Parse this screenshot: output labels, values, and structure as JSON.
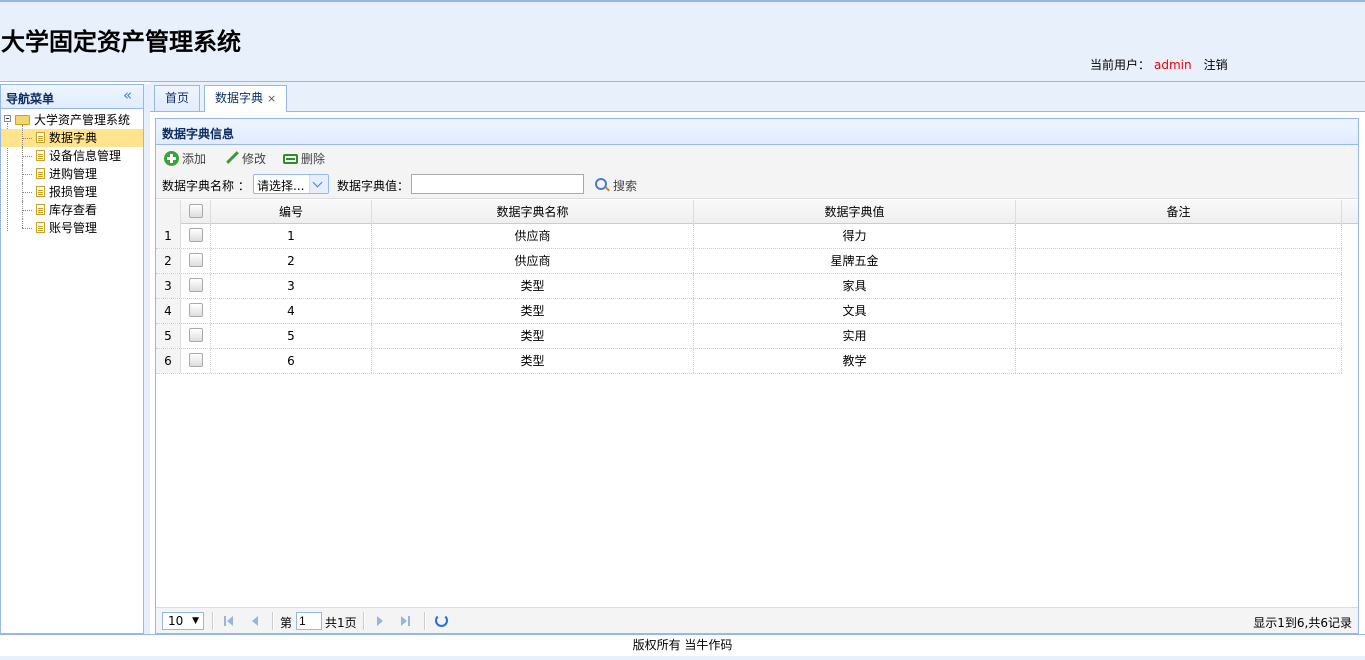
{
  "app": {
    "title": "大学固定资产管理系统",
    "user_label": "当前用户：",
    "username": "admin",
    "logout_label": "注销"
  },
  "nav": {
    "title": "导航菜单",
    "collapse_icon": "double-chevron-left-icon",
    "root_label": "大学资产管理系统",
    "items": [
      {
        "label": "数据字典",
        "selected": true
      },
      {
        "label": "设备信息管理",
        "selected": false
      },
      {
        "label": "进购管理",
        "selected": false
      },
      {
        "label": "报损管理",
        "selected": false
      },
      {
        "label": "库存查看",
        "selected": false
      },
      {
        "label": "账号管理",
        "selected": false
      }
    ]
  },
  "tabs": [
    {
      "label": "首页",
      "active": false,
      "closable": false
    },
    {
      "label": "数据字典",
      "active": true,
      "closable": true,
      "close_label": "×"
    }
  ],
  "panel": {
    "title": "数据字典信息"
  },
  "toolbar": {
    "add_label": "添加",
    "edit_label": "修改",
    "delete_label": "删除",
    "name_filter_label": "数据字典名称 ：",
    "name_filter_value": "请选择...",
    "value_filter_label": "数据字典值：",
    "value_filter_value": "",
    "search_label": "搜索"
  },
  "grid": {
    "columns": [
      "编号",
      "数据字典名称",
      "数据字典值",
      "备注"
    ],
    "rows": [
      {
        "rownum": "1",
        "id": "1",
        "name": "供应商",
        "value": "得力",
        "note": ""
      },
      {
        "rownum": "2",
        "id": "2",
        "name": "供应商",
        "value": "星牌五金",
        "note": ""
      },
      {
        "rownum": "3",
        "id": "3",
        "name": "类型",
        "value": "家具",
        "note": ""
      },
      {
        "rownum": "4",
        "id": "4",
        "name": "类型",
        "value": "文具",
        "note": ""
      },
      {
        "rownum": "5",
        "id": "5",
        "name": "类型",
        "value": "实用",
        "note": ""
      },
      {
        "rownum": "6",
        "id": "6",
        "name": "类型",
        "value": "教学",
        "note": ""
      }
    ]
  },
  "pager": {
    "page_size": "10",
    "page_prefix": "第",
    "page_number": "1",
    "page_suffix": "共1页",
    "summary": "显示1到6,共6记录"
  },
  "footer": {
    "text": "版权所有 当牛作码"
  }
}
